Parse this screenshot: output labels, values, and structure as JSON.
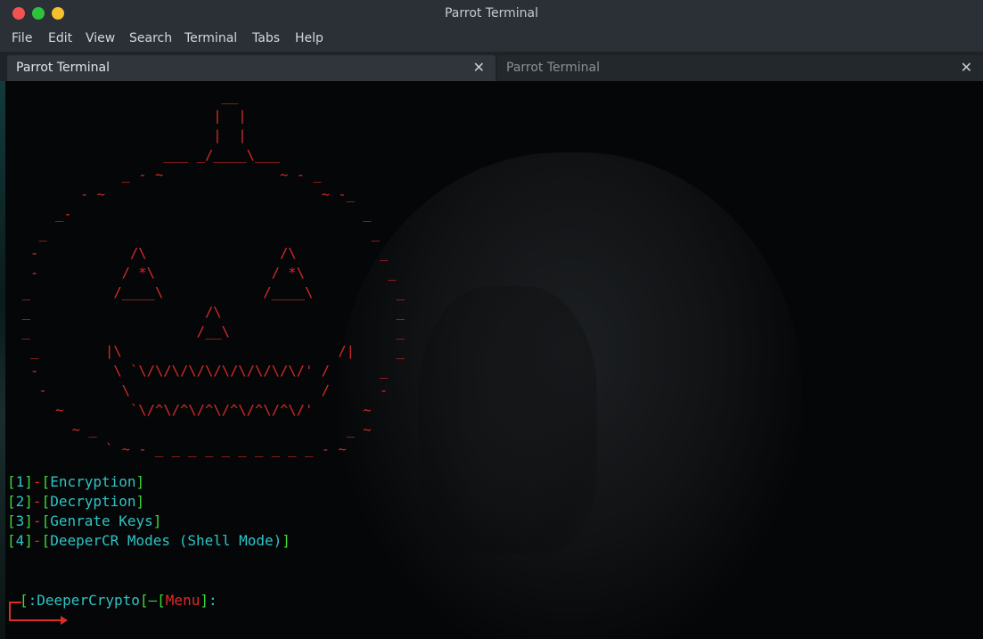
{
  "window": {
    "title": "Parrot Terminal"
  },
  "menu": [
    "File",
    "Edit",
    "View",
    "Search",
    "Terminal",
    "Tabs",
    "Help"
  ],
  "tabs": [
    {
      "label": "Parrot Terminal",
      "active": true
    },
    {
      "label": "Parrot Terminal",
      "active": false
    }
  ],
  "terminal": {
    "ascii_art": "                          __\n                         |  |\n                         |  |\n                   ___ _/____\\___\n              _ - ~              ~ - _\n         - ~                          ~ -_\n      _-                                   _\n    _                                       _\n   -           /\\                /\\          _\n   -          / *\\              / *\\          _\n  _          /____\\            /____\\          _\n  _                     /\\                     _\n  _                    /__\\                    _\n   _        |\\                          /|     _\n   -         \\ `\\/\\/\\/\\/\\/\\/\\/\\/\\/\\/' /      _\n    -         \\                       /      -\n      ~        `\\/^\\/^\\/^\\/^\\/^\\/^\\/'      ~\n        ~ _                              _ ~\n            ` ~ - _ _ _ _ _ _ _ _ _ _ - ~",
    "options": [
      {
        "num": "1",
        "label": "Encryption"
      },
      {
        "num": "2",
        "label": "Decryption"
      },
      {
        "num": "3",
        "label": "Genrate Keys"
      },
      {
        "num": "4",
        "label": "DeeperCR Modes (Shell Mode)"
      }
    ],
    "prompt": {
      "name": ":DeeperCrypto",
      "dash": "—",
      "section": "Menu",
      "suffix": ":"
    }
  },
  "colors": {
    "art": "#d92b2b",
    "bracket": "#3fd83a",
    "text": "#2ec4c4",
    "accent_red": "#e02a2a"
  }
}
